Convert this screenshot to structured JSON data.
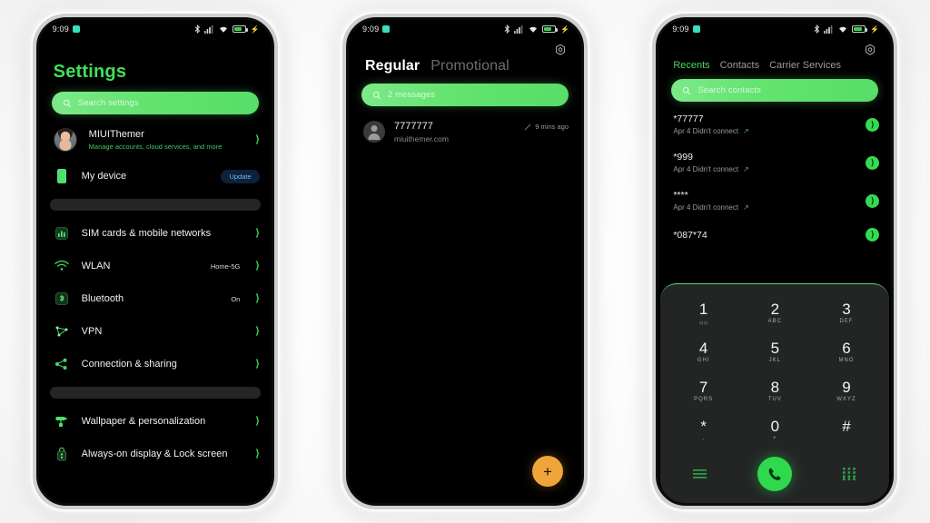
{
  "background": "#ffffff",
  "accent_green": "#3fe055",
  "statusbar": {
    "time": "9:09",
    "icons": [
      "bluetooth-icon",
      "signal-icon",
      "wifi-icon",
      "battery-icon",
      "charging-bolt-icon"
    ]
  },
  "settings_screen": {
    "title": "Settings",
    "search": {
      "placeholder": "Search settings",
      "icon": "search-icon"
    },
    "account": {
      "name": "MIUIThemer",
      "subtitle": "Manage accounts, cloud services, and more",
      "avatar": "user-avatar"
    },
    "device": {
      "label": "My device",
      "badge": "Update",
      "icon": "device-phone-icon"
    },
    "group_one": [
      {
        "label": "SIM cards & mobile networks",
        "value": "",
        "icon": "sim-card-icon"
      },
      {
        "label": "WLAN",
        "value": "Home-5G",
        "icon": "wifi-icon"
      },
      {
        "label": "Bluetooth",
        "value": "On",
        "icon": "bluetooth-icon"
      },
      {
        "label": "VPN",
        "value": "",
        "icon": "vpn-icon"
      },
      {
        "label": "Connection & sharing",
        "value": "",
        "icon": "share-icon"
      }
    ],
    "group_two": [
      {
        "label": "Wallpaper & personalization",
        "value": "",
        "icon": "paint-roller-icon"
      },
      {
        "label": "Always-on display & Lock screen",
        "value": "",
        "icon": "lock-icon"
      }
    ]
  },
  "messages_screen": {
    "gear": "settings-gear-icon",
    "tabs": [
      {
        "label": "Regular",
        "active": true
      },
      {
        "label": "Promotional",
        "active": false
      }
    ],
    "search": {
      "placeholder": "2 messages",
      "icon": "search-icon"
    },
    "conversations": [
      {
        "sender": "7777777",
        "preview": "miuithemer.com",
        "time": "9 mins ago",
        "status_icon": "sent-pencil-icon",
        "avatar": "contact-placeholder-avatar"
      }
    ],
    "fab": {
      "label": "+",
      "icon": "compose-plus-icon",
      "color": "#f0a53a"
    }
  },
  "dialer_screen": {
    "gear": "settings-gear-icon",
    "tabs": [
      {
        "label": "Recents",
        "active": true
      },
      {
        "label": "Contacts",
        "active": false
      },
      {
        "label": "Carrier Services",
        "active": false
      }
    ],
    "search": {
      "placeholder": "Search contacts",
      "icon": "search-icon"
    },
    "calls": [
      {
        "number": "*77777",
        "detail": "Apr 4 Didn't connect",
        "direction_icon": "outgoing-call-arrow-icon"
      },
      {
        "number": "*999",
        "detail": "Apr 4 Didn't connect",
        "direction_icon": "outgoing-call-arrow-icon"
      },
      {
        "number": "****",
        "detail": "Apr 4 Didn't connect",
        "direction_icon": "outgoing-call-arrow-icon"
      },
      {
        "number": "*087*74",
        "detail": "",
        "direction_icon": "outgoing-call-arrow-icon"
      }
    ],
    "keypad": [
      {
        "digit": "1",
        "letters": "○○"
      },
      {
        "digit": "2",
        "letters": "ABC"
      },
      {
        "digit": "3",
        "letters": "DEF"
      },
      {
        "digit": "4",
        "letters": "GHI"
      },
      {
        "digit": "5",
        "letters": "JKL"
      },
      {
        "digit": "6",
        "letters": "MNO"
      },
      {
        "digit": "7",
        "letters": "PQRS"
      },
      {
        "digit": "8",
        "letters": "TUV"
      },
      {
        "digit": "9",
        "letters": "WXYZ"
      },
      {
        "digit": "*",
        "letters": ","
      },
      {
        "digit": "0",
        "letters": "+"
      },
      {
        "digit": "#",
        "letters": ""
      }
    ],
    "actions": {
      "left_icon": "call-log-list-icon",
      "call_icon": "phone-call-icon",
      "right_icon": "keypad-grid-icon"
    }
  }
}
